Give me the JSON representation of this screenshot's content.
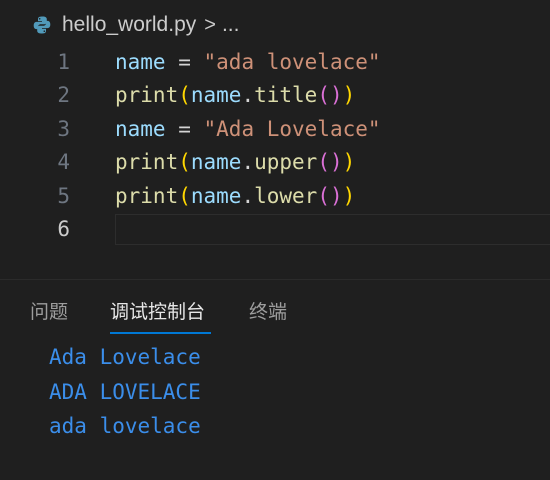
{
  "breadcrumb": {
    "file_icon": "python-icon",
    "file_name": "hello_world.py",
    "separator": ">",
    "more": "..."
  },
  "editor": {
    "active_line": 6,
    "lines": [
      {
        "number": "1",
        "tokens": [
          [
            "v",
            "name"
          ],
          [
            "o",
            " = "
          ],
          [
            "s",
            "\"ada lovelace\""
          ]
        ]
      },
      {
        "number": "2",
        "tokens": [
          [
            "f",
            "print"
          ],
          [
            "p",
            "("
          ],
          [
            "v",
            "name"
          ],
          [
            "o",
            "."
          ],
          [
            "f",
            "title"
          ],
          [
            "p2",
            "()"
          ],
          [
            "p",
            ")"
          ]
        ]
      },
      {
        "number": "3",
        "tokens": [
          [
            "v",
            "name"
          ],
          [
            "o",
            " = "
          ],
          [
            "s",
            "\"Ada Lovelace\""
          ]
        ]
      },
      {
        "number": "4",
        "tokens": [
          [
            "f",
            "print"
          ],
          [
            "p",
            "("
          ],
          [
            "v",
            "name"
          ],
          [
            "o",
            "."
          ],
          [
            "f",
            "upper"
          ],
          [
            "p2",
            "()"
          ],
          [
            "p",
            ")"
          ]
        ]
      },
      {
        "number": "5",
        "tokens": [
          [
            "f",
            "print"
          ],
          [
            "p",
            "("
          ],
          [
            "v",
            "name"
          ],
          [
            "o",
            "."
          ],
          [
            "f",
            "lower"
          ],
          [
            "p2",
            "()"
          ],
          [
            "p",
            ")"
          ]
        ]
      },
      {
        "number": "6",
        "tokens": []
      }
    ]
  },
  "panel": {
    "tabs": [
      {
        "label": "问题",
        "active": false
      },
      {
        "label": "调试控制台",
        "active": true
      },
      {
        "label": "终端",
        "active": false
      }
    ],
    "output": [
      "Ada Lovelace",
      "ADA LOVELACE",
      "ada lovelace"
    ]
  },
  "colors": {
    "background": "#1f1f1f",
    "variable": "#9cdcfe",
    "function": "#dcdcaa",
    "string": "#ce9178",
    "bracket": "#ffd700",
    "bracket_nested": "#da70d6",
    "output": "#3b8eea",
    "tab_accent": "#0078d4"
  }
}
